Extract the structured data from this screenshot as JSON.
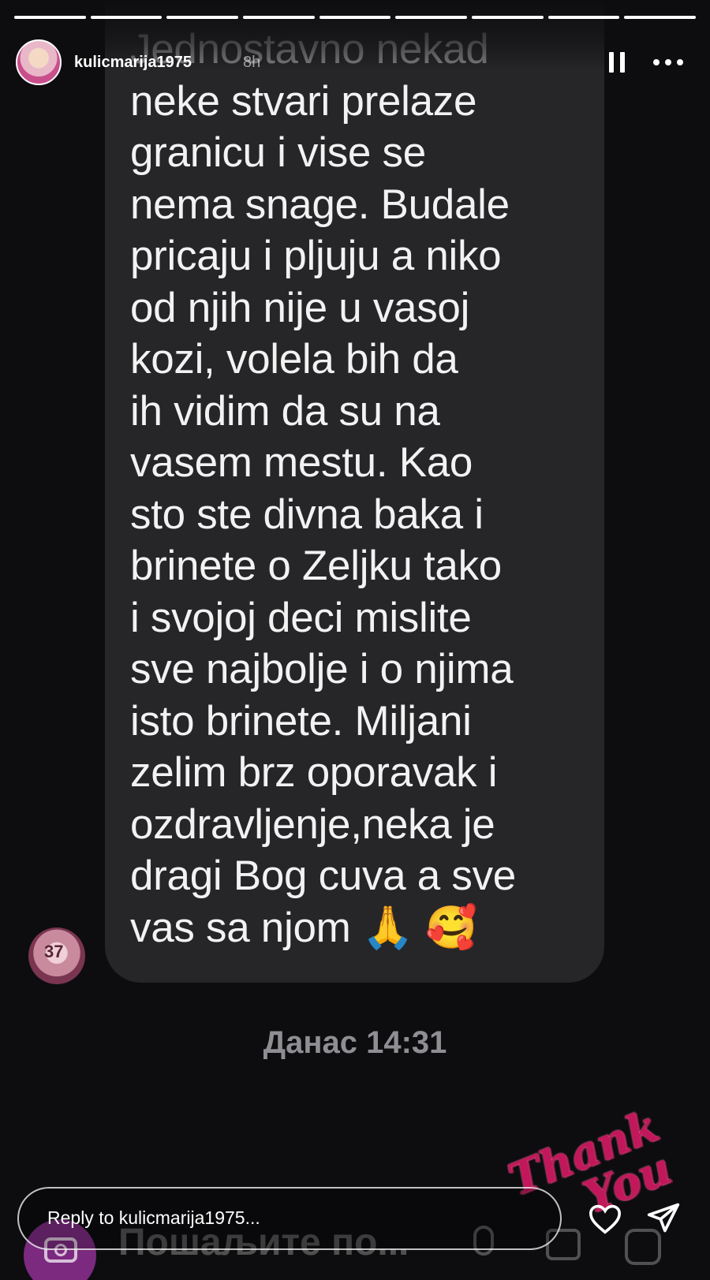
{
  "story": {
    "username": "kulicmarija1975",
    "time_ago": "8h",
    "progress_segments_total": 9,
    "progress_segments_done": 9
  },
  "message": {
    "lines": [
      "Jednostavno nekad",
      "neke stvari prelaze",
      "granicu i vise se",
      "nema snage. Budale",
      "pricaju i pljuju a niko",
      "od njih nije u vasoj",
      "kozi, volela bih da",
      "ih vidim da su na",
      "vasem mestu. Kao",
      "sto ste divna baka i",
      "brinete o Zeljku tako",
      "i svojoj deci mislite",
      "sve najbolje i o njima",
      "isto brinete. Miljani",
      "zelim brz oporavak i",
      "ozdravljenje,neka je",
      "dragi Bog cuva a sve",
      "vas sa njom 🙏 🥰"
    ],
    "sender_avatar_text": "37",
    "date_stamp": "Данас 14:31"
  },
  "sticker": {
    "line1": "Thank",
    "line2": "You"
  },
  "composer": {
    "placeholder": "Пошаљите по..."
  },
  "reply": {
    "placeholder": "Reply to kulicmarija1975..."
  },
  "colors": {
    "bubble": "#262629",
    "background": "#0d0d0f",
    "camera_button": "#7b2a7f",
    "sticker": "#c2185b"
  },
  "icons": [
    "pause-icon",
    "more-icon",
    "heart-icon",
    "send-icon",
    "camera-icon",
    "mic-icon",
    "gallery-icon",
    "sticker-icon"
  ]
}
